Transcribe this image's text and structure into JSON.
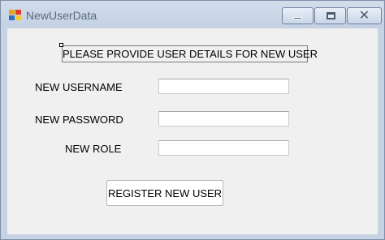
{
  "window": {
    "title": "NewUserData",
    "controls": {
      "minimize": "minimize",
      "maximize": "maximize",
      "close": "close"
    }
  },
  "form": {
    "header": "PLEASE PROVIDE USER DETAILS FOR NEW USER",
    "username_label": "NEW USERNAME",
    "username_value": "",
    "password_label": "NEW PASSWORD",
    "password_value": "",
    "role_label": "NEW ROLE",
    "role_value": "",
    "register_button": "REGISTER NEW USER"
  },
  "icons": {
    "app": "windows-forms-app-icon",
    "minimize": "minimize-icon",
    "maximize": "maximize-icon",
    "close": "close-icon"
  },
  "colors": {
    "titlebar": "#c4d1e3",
    "client_background": "#f0f0f0",
    "title_text": "#5a6a7e"
  }
}
